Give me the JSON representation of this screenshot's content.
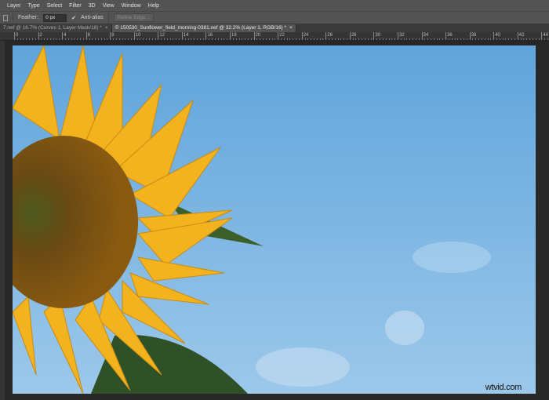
{
  "menu": [
    "Layer",
    "Type",
    "Select",
    "Filter",
    "3D",
    "View",
    "Window",
    "Help"
  ],
  "options": {
    "feather_label": "Feather:",
    "feather_value": "0 px",
    "antialias_label": "Anti-alias",
    "antialias_checked": true,
    "refine_edge": "Refine Edge..."
  },
  "tabs": [
    {
      "label": "7.nef @ 16.7% (Curves 1, Layer Mask/16) *",
      "close": "×",
      "active": false
    },
    {
      "label": "© 150530_Sunflower_field_morning-0381.nef @ 32.2% (Layer 1, RGB/16) *",
      "close": "×",
      "active": true
    }
  ],
  "ruler": {
    "labels": [
      "0",
      "2",
      "4",
      "6",
      "8",
      "10",
      "12",
      "14",
      "16",
      "18",
      "20",
      "22",
      "24",
      "26",
      "28",
      "30",
      "32",
      "34",
      "36",
      "38",
      "40",
      "42",
      "44"
    ]
  },
  "watermark": "wtvid.com"
}
